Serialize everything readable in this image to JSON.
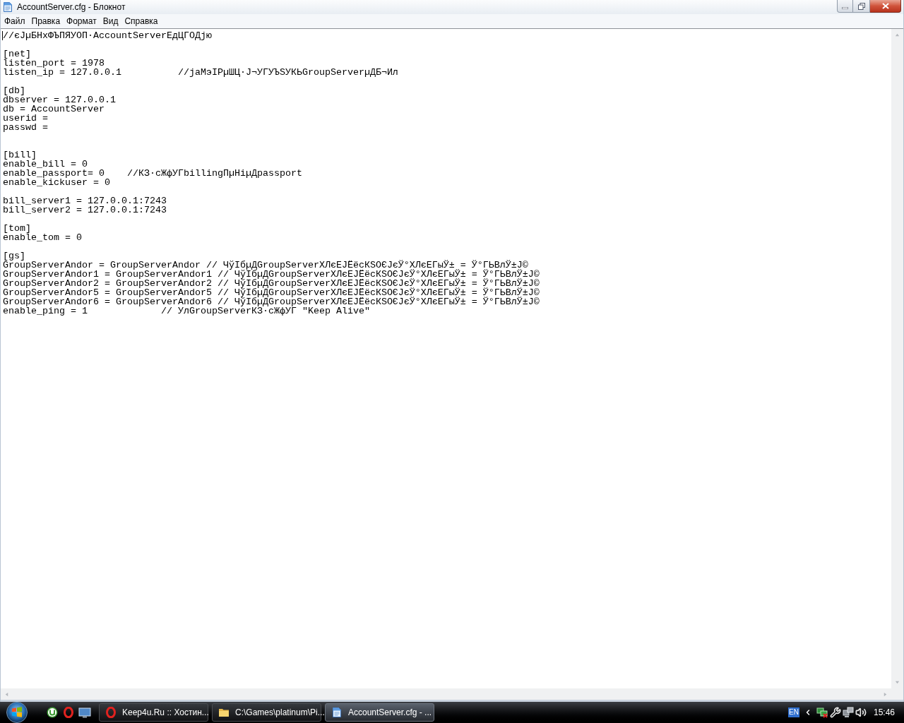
{
  "window": {
    "title": "AccountServer.cfg - Блокнот"
  },
  "menu": [
    "Файл",
    "Правка",
    "Формат",
    "Вид",
    "Справка"
  ],
  "editor": {
    "lines": [
      {
        "kind": "text",
        "text": "//єЈµБНхФЪПЯУОП·AccountServerЕдЦГОДјю"
      },
      {
        "kind": "blank"
      },
      {
        "kind": "text",
        "text": "[net]"
      },
      {
        "kind": "text",
        "text": "listen_port = 1978"
      },
      {
        "kind": "text",
        "text": "listen_ip = 127.0.0.1          //јаМэIPµШЦ·Ј¬УГУЪЅУКЬGroupServerµДБ¬Ил"
      },
      {
        "kind": "blank"
      },
      {
        "kind": "text",
        "text": "[db]"
      },
      {
        "kind": "text",
        "text": "dbserver = 127.0.0.1"
      },
      {
        "kind": "text",
        "text": "db = AccountServer"
      },
      {
        "kind": "text",
        "text": "userid ="
      },
      {
        "kind": "text",
        "text": "passwd ="
      },
      {
        "kind": "blank"
      },
      {
        "kind": "blank"
      },
      {
        "kind": "text",
        "text": "[bill]"
      },
      {
        "kind": "text",
        "text": "enable_bill = 0"
      },
      {
        "kind": "text",
        "text": "enable_passport= 0    //КЗ·сЖфУГbillingПµНіµДpassport"
      },
      {
        "kind": "text",
        "text": "enable_kickuser = 0"
      },
      {
        "kind": "blank"
      },
      {
        "kind": "text",
        "text": "bill_server1 = 127.0.0.1:7243"
      },
      {
        "kind": "text",
        "text": "bill_server2 = 127.0.0.1:7243"
      },
      {
        "kind": "blank"
      },
      {
        "kind": "text",
        "text": "[tom]"
      },
      {
        "kind": "text",
        "text": "enable_tom = 0"
      },
      {
        "kind": "blank"
      },
      {
        "kind": "text",
        "text": "[gs]"
      },
      {
        "kind": "text",
        "text": "GroupServerAndor = GroupServerAndor // ЧўІбµДGroupServerХЛєЕЈЁёсКЅОЄЈєЎ°ХЛєЕГыЎ± = Ў°ГЬВлЎ±Ј©"
      },
      {
        "kind": "text",
        "text": "GroupServerAndor1 = GroupServerAndor1 // ЧўІбµДGroupServerХЛєЕЈЁёсКЅОЄЈєЎ°ХЛєЕГыЎ± = Ў°ГЬВлЎ±Ј©"
      },
      {
        "kind": "text",
        "text": "GroupServerAndor2 = GroupServerAndor2 // ЧўІбµДGroupServerХЛєЕЈЁёсКЅОЄЈєЎ°ХЛєЕГыЎ± = Ў°ГЬВлЎ±Ј©"
      },
      {
        "kind": "text",
        "text": "GroupServerAndor5 = GroupServerAndor5 // ЧўІбµДGroupServerХЛєЕЈЁёсКЅОЄЈєЎ°ХЛєЕГыЎ± = Ў°ГЬВлЎ±Ј©"
      },
      {
        "kind": "text",
        "text": "GroupServerAndor6 = GroupServerAndor6 // ЧўІбµДGroupServerХЛєЕЈЁёсКЅОЄЈєЎ°ХЛєЕГыЎ± = Ў°ГЬВлЎ±Ј©"
      },
      {
        "kind": "text",
        "text": "enable_ping = 1             // УлGroupServerКЗ·сЖфУГ \"Keep Alive\""
      }
    ]
  },
  "taskbar": {
    "tasks": [
      {
        "label": "Keep4u.Ru :: Хостин...",
        "selected": false
      },
      {
        "label": "C:\\Games\\platinum\\Pi...",
        "selected": false
      },
      {
        "label": "AccountServer.cfg - ...",
        "selected": true
      }
    ],
    "language": "EN",
    "clock": "15:46"
  }
}
